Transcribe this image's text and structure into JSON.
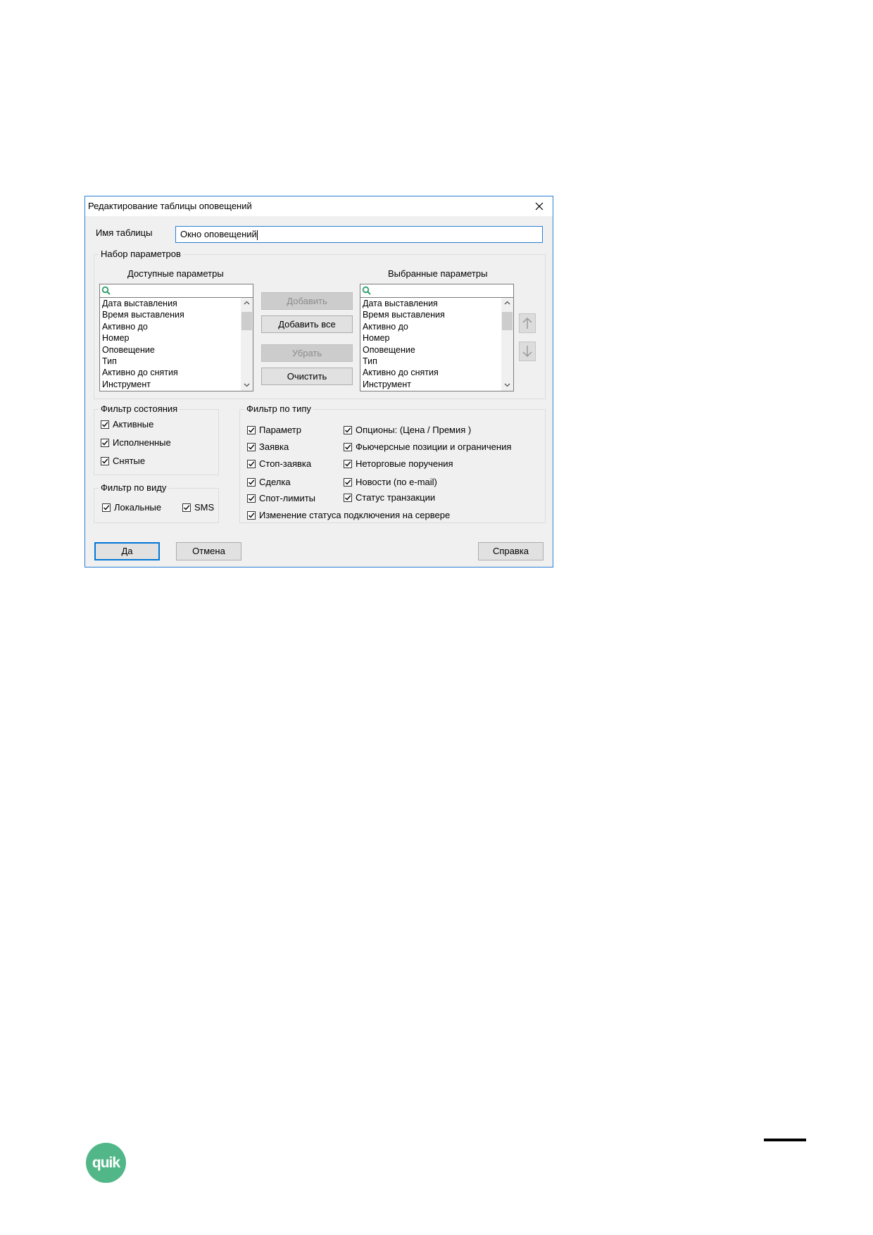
{
  "dialog": {
    "title": "Редактирование таблицы оповещений",
    "table_name_label": "Имя таблицы",
    "table_name_value": "Окно оповещений"
  },
  "params": {
    "group_title": "Набор параметров",
    "available_label": "Доступные параметры",
    "selected_label": "Выбранные параметры",
    "available_items": [
      "Дата выставления",
      "Время выставления",
      "Активно до",
      "Номер",
      "Оповещение",
      "Тип",
      "Активно до снятия",
      "Инструмент"
    ],
    "selected_items": [
      "Дата выставления",
      "Время выставления",
      "Активно до",
      "Номер",
      "Оповещение",
      "Тип",
      "Активно до снятия",
      "Инструмент"
    ],
    "add_label": "Добавить",
    "add_all_label": "Добавить все",
    "remove_label": "Убрать",
    "clear_label": "Очистить"
  },
  "state_filter": {
    "title": "Фильтр состояния",
    "items": [
      {
        "label": "Активные",
        "checked": true
      },
      {
        "label": "Исполненные",
        "checked": true
      },
      {
        "label": "Снятые",
        "checked": true
      }
    ]
  },
  "view_filter": {
    "title": "Фильтр по виду",
    "items": [
      {
        "label": "Локальные",
        "checked": true
      },
      {
        "label": "SMS",
        "checked": true
      }
    ]
  },
  "type_filter": {
    "title": "Фильтр по типу",
    "left": [
      {
        "label": "Параметр",
        "checked": true
      },
      {
        "label": "Заявка",
        "checked": true
      },
      {
        "label": "Стоп-заявка",
        "checked": true
      },
      {
        "label": "Сделка",
        "checked": true
      },
      {
        "label": "Спот-лимиты",
        "checked": true
      }
    ],
    "right": [
      {
        "label": "Опционы: (Цена / Премия )",
        "checked": true
      },
      {
        "label": "Фьючерсные позиции и ограничения",
        "checked": true
      },
      {
        "label": "Неторговые поручения",
        "checked": true
      },
      {
        "label": "Новости (по e-mail)",
        "checked": true
      },
      {
        "label": "Статус транзакции",
        "checked": true
      }
    ],
    "bottom": {
      "label": "Изменение статуса подключения на сервере",
      "checked": true
    }
  },
  "footer": {
    "ok_label": "Да",
    "cancel_label": "Отмена",
    "help_label": "Справка"
  },
  "brand": {
    "logo_text": "quik",
    "logo_color": "#52b788"
  },
  "colors": {
    "accent": "#0078d7",
    "search_icon": "#2e9e6b"
  }
}
